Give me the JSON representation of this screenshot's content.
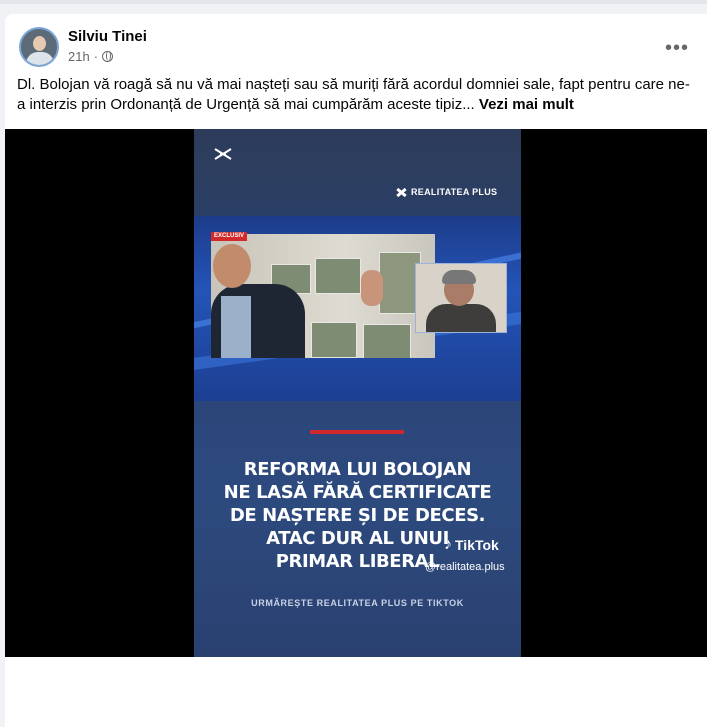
{
  "post": {
    "author": "Silviu Tinei",
    "time": "21h",
    "separator": "·",
    "more_label": "•••",
    "text": "Dl. Bolojan vă roagă să nu vă mai nașteți sau să muriți fără acordul domniei sale, fapt pentru care ne-a interzis prin Ordonanță de Urgență să mai cumpărăm aceste tipiz...",
    "see_more": "Vezi mai mult"
  },
  "video": {
    "brand": "REALITATEA PLUS",
    "badge": "EXCLUSIV",
    "headline": [
      "REFORMA LUI BOLOJAN",
      "NE LASĂ FĂRĂ CERTIFICATE",
      "DE NAȘTERE ȘI DE DECES.",
      "ATAC DUR AL UNUI",
      "PRIMAR LIBERAL"
    ],
    "tiktok_label": "TikTok",
    "tiktok_handle": "@realitatea.plus",
    "cta": "URMĂREȘTE REALITATEA PLUS PE TIKTOK"
  },
  "colors": {
    "card": "#ffffff",
    "video_bg": "#000000",
    "accent_red": "#d0272d"
  },
  "icons": [
    "avatar",
    "globe-icon",
    "more-icon",
    "capcut-icon",
    "realitatea-logo-icon",
    "tiktok-icon"
  ]
}
